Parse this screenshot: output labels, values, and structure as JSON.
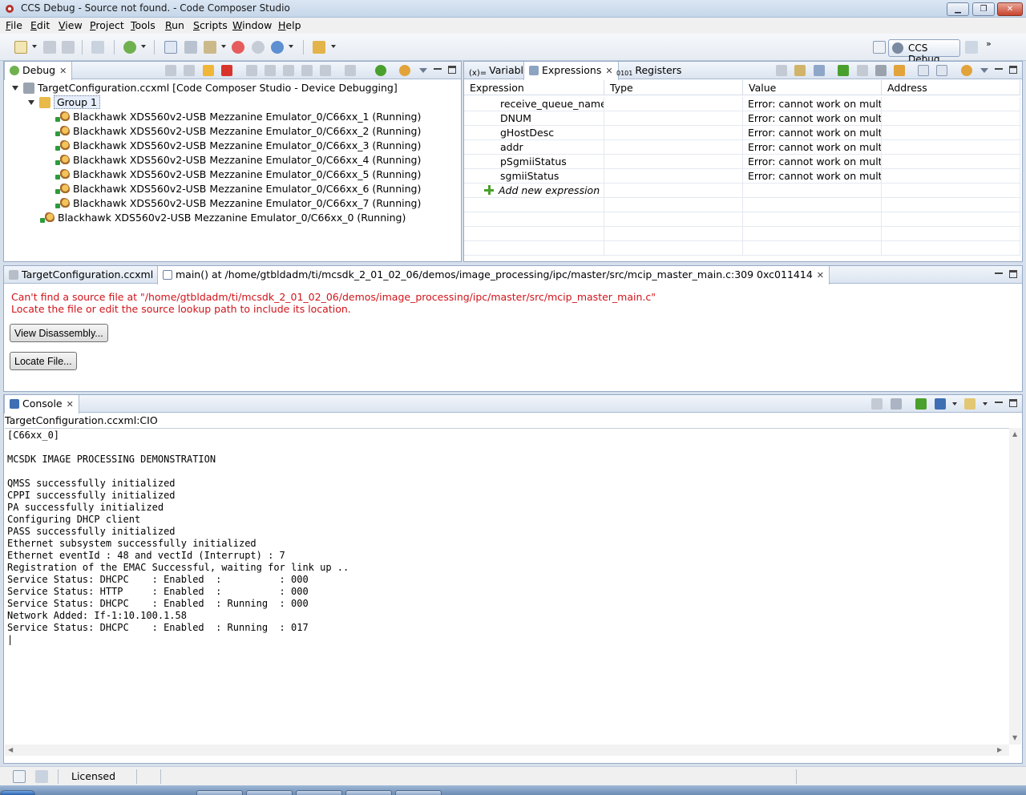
{
  "window": {
    "title": "CCS Debug - Source not found. - Code Composer Studio",
    "min_symbol": "▁",
    "max_symbol": "❐",
    "close_symbol": "✕"
  },
  "menu": [
    {
      "label": "File",
      "ul": "F",
      "rest": "ile"
    },
    {
      "label": "Edit",
      "ul": "E",
      "rest": "dit"
    },
    {
      "label": "View",
      "ul": "V",
      "rest": "iew"
    },
    {
      "label": "Project",
      "ul": "P",
      "rest": "roject"
    },
    {
      "label": "Tools",
      "ul": "T",
      "rest": "ools"
    },
    {
      "label": "Run",
      "ul": "R",
      "rest": "un"
    },
    {
      "label": "Scripts",
      "ul": "S",
      "rest": "cripts"
    },
    {
      "label": "Window",
      "ul": "W",
      "rest": "indow"
    },
    {
      "label": "Help",
      "ul": "H",
      "rest": "elp"
    }
  ],
  "perspective": {
    "label": "CCS Debug"
  },
  "debug_view": {
    "tab_label": "Debug",
    "config": "TargetConfiguration.ccxml [Code Composer Studio - Device Debugging]",
    "group": "Group 1",
    "cores": [
      "Blackhawk XDS560v2-USB Mezzanine Emulator_0/C66xx_1 (Running)",
      "Blackhawk XDS560v2-USB Mezzanine Emulator_0/C66xx_2 (Running)",
      "Blackhawk XDS560v2-USB Mezzanine Emulator_0/C66xx_3 (Running)",
      "Blackhawk XDS560v2-USB Mezzanine Emulator_0/C66xx_4 (Running)",
      "Blackhawk XDS560v2-USB Mezzanine Emulator_0/C66xx_5 (Running)",
      "Blackhawk XDS560v2-USB Mezzanine Emulator_0/C66xx_6 (Running)",
      "Blackhawk XDS560v2-USB Mezzanine Emulator_0/C66xx_7 (Running)"
    ],
    "core0": "Blackhawk XDS560v2-USB Mezzanine Emulator_0/C66xx_0 (Running)"
  },
  "expressions_view": {
    "tabs": {
      "variables": "Variables",
      "expressions": "Expressions",
      "registers": "Registers"
    },
    "columns": [
      "Expression",
      "Type",
      "Value",
      "Address"
    ],
    "rows": [
      {
        "expression": "receive_queue_name",
        "type": "",
        "value": "Error: cannot work on multipl...",
        "address": ""
      },
      {
        "expression": "DNUM",
        "type": "",
        "value": "Error: cannot work on multipl...",
        "address": ""
      },
      {
        "expression": "gHostDesc",
        "type": "",
        "value": "Error: cannot work on multipl...",
        "address": ""
      },
      {
        "expression": "addr",
        "type": "",
        "value": "Error: cannot work on multipl...",
        "address": ""
      },
      {
        "expression": "pSgmiiStatus",
        "type": "",
        "value": "Error: cannot work on multipl...",
        "address": ""
      },
      {
        "expression": "sgmiiStatus",
        "type": "",
        "value": "Error: cannot work on multipl...",
        "address": ""
      }
    ],
    "add_new": "Add new expression"
  },
  "editor": {
    "tab1": "TargetConfiguration.ccxml",
    "tab2": "main() at /home/gtbldadm/ti/mcsdk_2_01_02_06/demos/image_processing/ipc/master/src/mcip_master_main.c:309 0xc011414",
    "error_line1": "Can't find a source file at \"/home/gtbldadm/ti/mcsdk_2_01_02_06/demos/image_processing/ipc/master/src/mcip_master_main.c\"",
    "error_line2": "Locate the file or edit the source lookup path to include its location.",
    "view_disassembly": "View Disassembly...",
    "locate_file": "Locate File..."
  },
  "console": {
    "tab_label": "Console",
    "source": "TargetConfiguration.ccxml:CIO",
    "lines": [
      "[C66xx_0]",
      "",
      "MCSDK IMAGE PROCESSING DEMONSTRATION",
      "",
      "QMSS successfully initialized",
      "CPPI successfully initialized",
      "PA successfully initialized",
      "Configuring DHCP client",
      "PASS successfully initialized",
      "Ethernet subsystem successfully initialized",
      "Ethernet eventId : 48 and vectId (Interrupt) : 7",
      "Registration of the EMAC Successful, waiting for link up ..",
      "Service Status: DHCPC    : Enabled  :          : 000",
      "Service Status: HTTP     : Enabled  :          : 000",
      "Service Status: DHCPC    : Enabled  : Running  : 000",
      "Network Added: If-1:10.100.1.58",
      "Service Status: DHCPC    : Enabled  : Running  : 017",
      "|"
    ]
  },
  "status": {
    "licensed": "Licensed"
  },
  "colors": {
    "error_text": "#d0141a",
    "accent_green": "#4aa02c"
  }
}
